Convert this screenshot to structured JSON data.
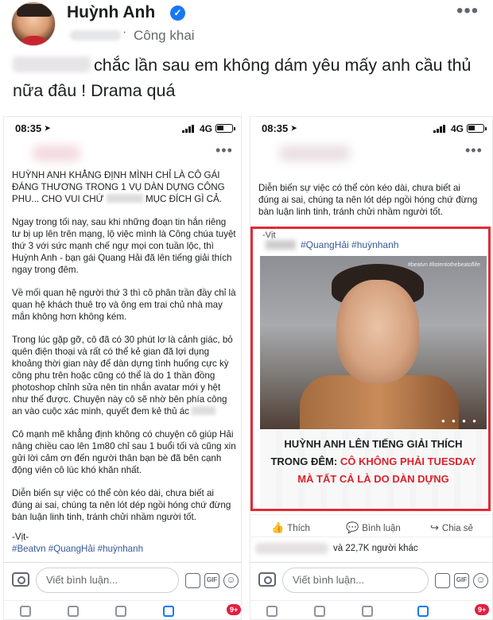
{
  "post": {
    "author": "Huỳnh Anh",
    "visibility": "Công khai",
    "caption": "chắc lần sau em không dám yêu mấy anh cầu thủ nữa đâu ! Drama quá"
  },
  "left_phone": {
    "time": "08:35",
    "network": "4G",
    "paragraphs": [
      "HUỲNH ANH KHẲNG ĐỊNH MÌNH CHỈ LÀ CÔ GÁI ĐÁNG THƯƠNG TRONG 1 VỤ DÀN DỰNG CÔNG PHU... CHO VUI CHỨ",
      "MỤC ĐÍCH GÌ CẢ.",
      "Ngay trong tối nay, sau khi những đoạn tin hắn riêng tư bị up lên trên mạng, lộ việc mình là Công chúa tuyệt thứ 3 với sức mạnh chế ngự mọi con tuần lộc, thì Huỳnh Anh - bạn gái Quang Hải đã lên tiếng giải thích ngay trong đêm.",
      "Về mối quan hệ người thứ 3 thì cô phân trần đầy chỉ là quan hệ khách thuê trọ và ông em trai chủ nhà may mắn không hơn không kém.",
      "Trong lúc gặp gỡ, cô đã có 30 phút lơ là cảnh giác, bỏ quên điện thoại và rất có thể kẻ gian đã lợi dụng khoảng thời gian này để dàn dựng tình huống cực kỳ công phu trên hoặc cũng có thể là do 1 thần đồng photoshop chỉnh sửa nên tin nhắn avatar mới y hệt như thế được. Chuyện này cô sẽ nhờ bên phía công an vào cuộc xác minh, quyết đem kẻ thủ ác",
      "Cô mạnh mẽ khẳng định không có chuyện cô giúp Hải nâng chiều cao lên 1m80 chỉ sau 1 buổi tối và cũng xin gửi lời cảm ơn đến người thân bạn bè đã bên cạnh động viên cô lúc khó khăn nhất.",
      "Diễn biến sự việc có thể còn kéo dài, chưa biết ai đúng ai sai, chúng ta nên lót dép ngồi hóng chứ đừng bàn luận linh tinh, tránh chửi nhầm người tốt.",
      "-Vịt-",
      "#Beatvn #QuangHải #huỳnhanh"
    ],
    "comment_placeholder": "Viết bình luận...",
    "gif": "GIF",
    "badge": "9+"
  },
  "right_phone": {
    "time": "08:35",
    "network": "4G",
    "intro_text": "Diễn biến sự việc có thể còn kéo dài, chưa biết ai đúng ai sai, chúng ta nên lót dép ngồi hóng chứ đừng bàn luận linh tinh, tránh chửi nhầm người tốt.",
    "card": {
      "author_short": "-Vịt",
      "hashtags": "#QuangHải #huỳnhanh",
      "watermark": "#beatvn  #listentothebeatoflife",
      "headline_line1": "HUỲNH ANH LÊN TIẾNG GIẢI THÍCH",
      "headline_line2_prefix": "TRONG ĐÊM: ",
      "headline_line2_red": "CÔ KHÔNG PHẢI TUESDAY",
      "headline_line3": "MÀ TẤT CẢ LÀ DO DÀN DỰNG"
    },
    "actions": [
      "Thích",
      "Bình luận",
      "Chia sẻ"
    ],
    "reaction_count": "và 22,7K người khác",
    "comment_placeholder": "Viết bình luận...",
    "gif": "GIF",
    "badge": "9+"
  },
  "colors": {
    "accent_blue": "#1877f2",
    "frame_red": "#e22a35",
    "headline_red": "#d9232d",
    "link": "#385898"
  },
  "icons": [
    "verified-icon",
    "more-icon",
    "camera-icon",
    "gif-icon",
    "smile-icon",
    "like-icon",
    "comment-icon",
    "share-icon"
  ]
}
